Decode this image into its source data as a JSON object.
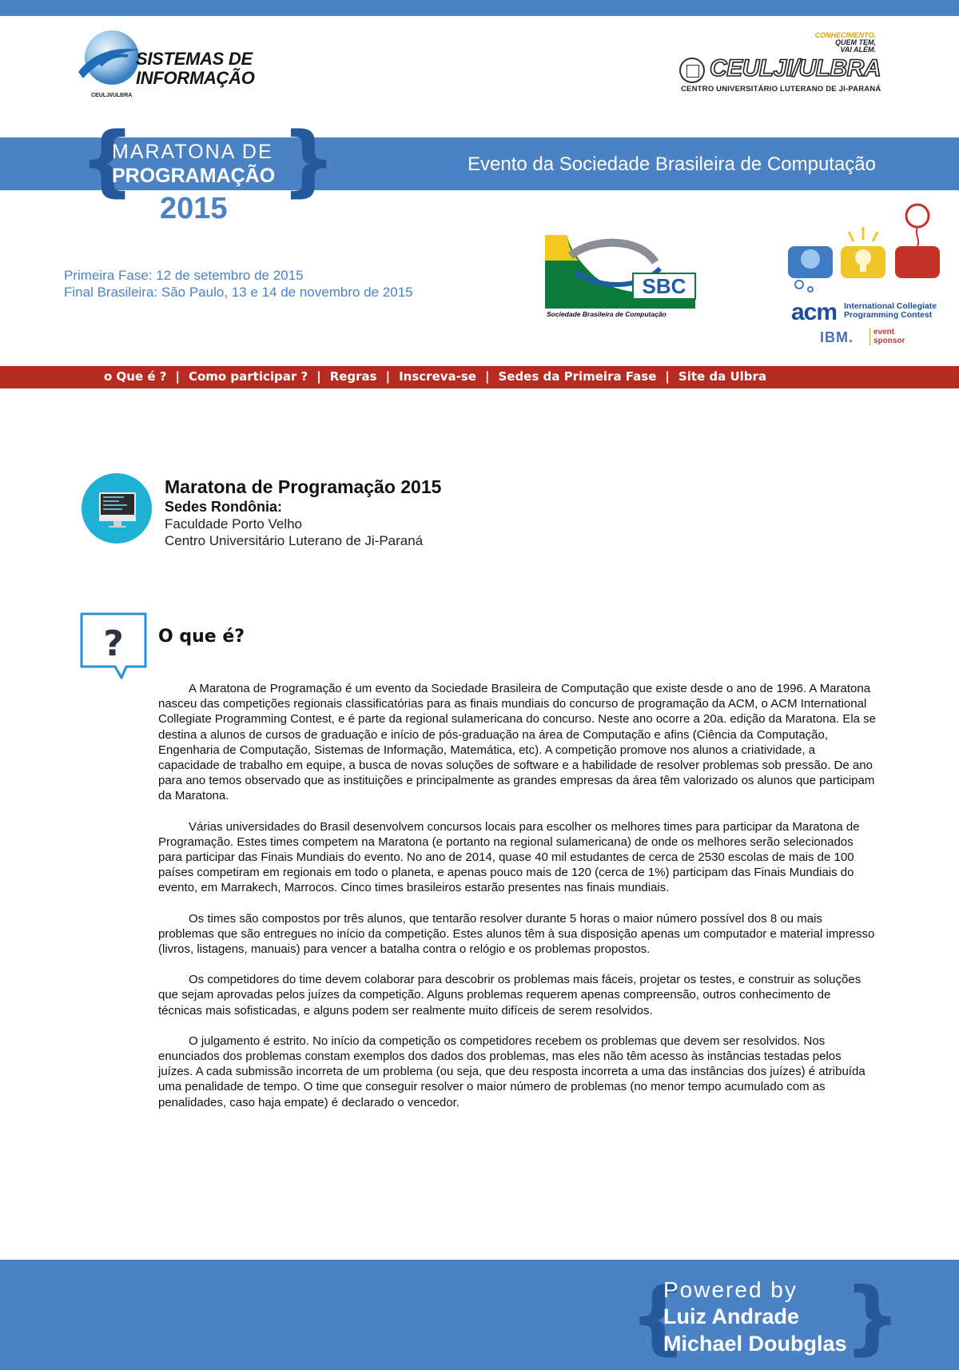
{
  "header": {
    "si_logo": {
      "title_line1": "SISTEMAS DE",
      "title_line2": "INFORMAÇÃO",
      "subtitle": "CEULJI/ULBRA"
    },
    "ulbra_logo": {
      "slogan_line1": "CONHECIMENTO.",
      "slogan_line2": "QUEM TEM,",
      "slogan_line3": "VAI ALÉM.",
      "name": "CEULJI/ULBRA",
      "full_name": "CENTRO UNIVERSITÁRIO LUTERANO DE JI-PARANÁ"
    },
    "maratona": {
      "line1": "MARATONA DE",
      "line2": "PROGRAMAÇÃO",
      "year": "2015",
      "brace_open": "{",
      "brace_close": "}"
    },
    "evento": "Evento da Sociedade Brasileira de Computação",
    "fase1": "Primeira Fase: 12 de setembro de 2015",
    "final": "Final Brasileira: São Paulo, 13 e 14 de novembro de 2015",
    "sbc": {
      "abbr": "SBC",
      "name": "Sociedade Brasileira de Computação"
    },
    "acm": {
      "word": "acm",
      "line1": "International Collegiate",
      "line2": "Programming Contest",
      "ibm": "IBM.",
      "sponsor_line1": "event",
      "sponsor_line2": "sponsor"
    },
    "colors": {
      "brand_blue": "#4a82c4",
      "dark_blue": "#245a9c",
      "nav_red": "#b72c22",
      "cyan": "#1fb0d6"
    }
  },
  "nav": {
    "items": [
      "o Que é ?",
      "Como participar ?",
      "Regras",
      "Inscreva-se",
      "Sedes da Primeira Fase",
      "Site da Ulbra"
    ],
    "separator": "|"
  },
  "intro": {
    "icon": "monitor-icon",
    "title": "Maratona de Programação 2015",
    "subtitle": "Sedes Rondônia:",
    "sede1": "Faculdade Porto Velho",
    "sede2": "Centro Universitário Luterano de Ji-Paraná"
  },
  "section": {
    "icon": "question-bubble-icon",
    "heading": "O que é?",
    "paragraphs": [
      "A Maratona de Programação é um evento da Sociedade Brasileira de Computação que existe desde o ano de 1996. A Maratona nasceu das competições regionais classificatórias para as finais mundiais do concurso de programação da ACM, o ACM International Collegiate Programming Contest, e é parte da regional sulamericana do concurso. Neste ano ocorre a 20a. edição da Maratona. Ela se destina a alunos de cursos de graduação e início de pós-graduação na área de Computação e afins (Ciência da Computação, Engenharia de Computação, Sistemas de Informação, Matemática, etc). A competição promove nos alunos a criatividade, a capacidade de trabalho em equipe, a busca de novas soluções de software e a habilidade de resolver problemas sob pressão. De ano para ano temos observado que as instituições e principalmente as grandes empresas da área têm valorizado os alunos que participam da Maratona.",
      "Várias universidades do Brasil desenvolvem concursos locais para escolher os melhores times para participar da Maratona de Programação. Estes times competem na Maratona (e portanto na regional sulamericana) de onde os melhores serão selecionados para participar das Finais Mundiais do evento. No ano de 2014, quase 40 mil estudantes de cerca de 2530 escolas de mais de 100 países competiram em regionais em todo o planeta, e apenas pouco mais de 120 (cerca de 1%) participam das Finais Mundiais do evento, em Marrakech, Marrocos. Cinco times brasileiros estarão presentes nas finais mundiais.",
      "Os times são compostos por três alunos, que tentarão resolver durante 5 horas o maior número possível dos 8 ou mais problemas que são entregues no início da competição. Estes alunos têm à sua disposição apenas um computador e material impresso (livros, listagens, manuais) para vencer a batalha contra o relógio e os problemas propostos.",
      "Os competidores do time devem colaborar para descobrir os problemas mais fáceis, projetar os testes, e construir as soluções que sejam aprovadas pelos juízes da competição. Alguns problemas requerem apenas compreensão, outros conhecimento de técnicas mais sofisticadas, e alguns podem ser realmente muito difíceis de serem resolvidos.",
      "O julgamento é estrito. No início da competição os competidores recebem os problemas que devem ser resolvidos. Nos enunciados dos problemas constam exemplos dos dados dos problemas, mas eles não têm acesso às instâncias testadas pelos juízes. A cada submissão incorreta de um problema (ou seja, que deu resposta incorreta a uma das instâncias dos juízes) é atribuída uma penalidade de tempo. O time que conseguir resolver o maior número de problemas (no menor tempo acumulado com as penalidades, caso haja empate) é declarado o vencedor."
    ]
  },
  "footer": {
    "powered": "Powered by",
    "author1": "Luiz Andrade",
    "author2": "Michael Doubglas"
  }
}
